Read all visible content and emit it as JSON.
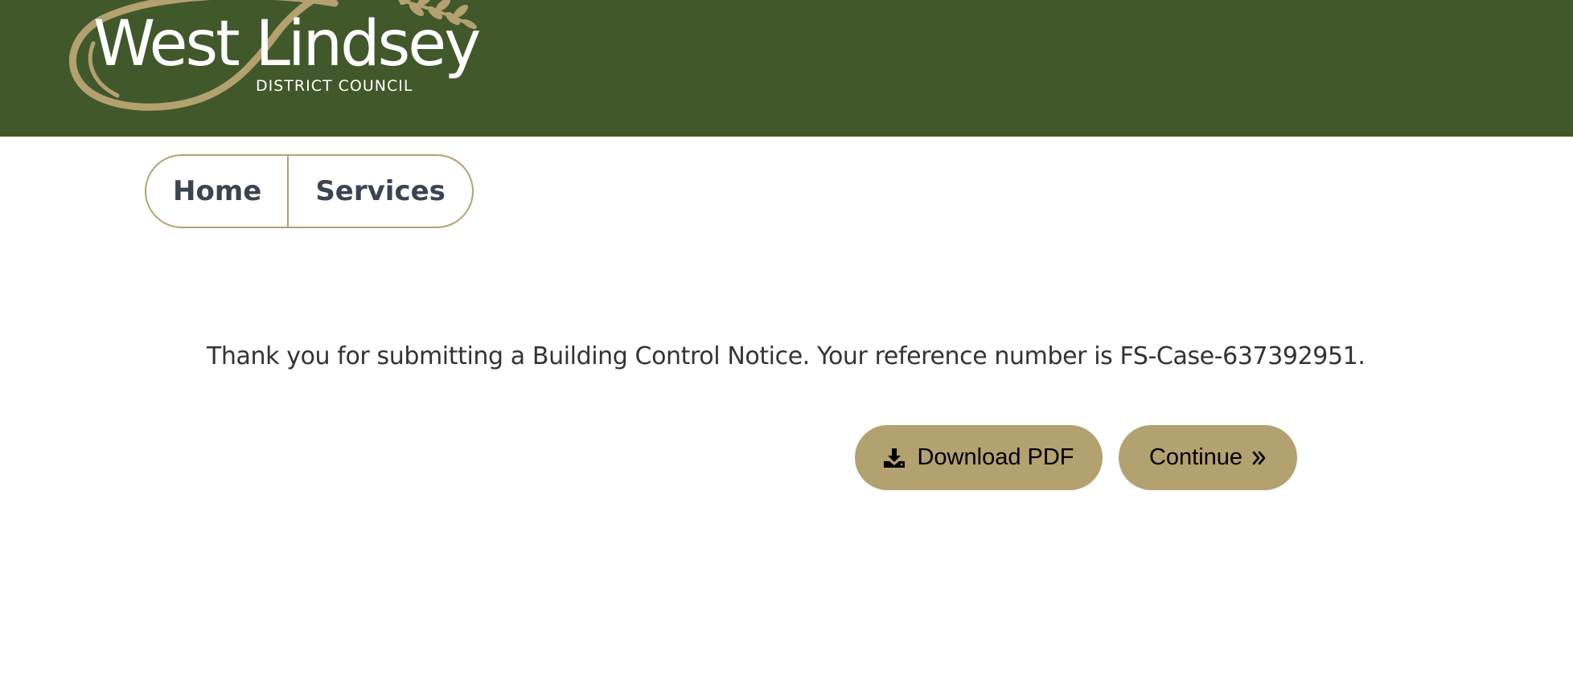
{
  "header": {
    "logo": {
      "name": "West Lindsey",
      "subtitle": "DISTRICT COUNCIL",
      "icon": "wheat-swoosh-logo"
    },
    "background_color": "#41582b",
    "accent_color": "#b3a16f"
  },
  "nav": {
    "items": [
      {
        "label": "Home"
      },
      {
        "label": "Services"
      }
    ]
  },
  "main": {
    "message": "Thank you for submitting a Building Control Notice. Your reference number is FS-Case-637392951.",
    "buttons": {
      "download_label": "Download PDF",
      "download_icon": "download-icon",
      "continue_label": "Continue",
      "continue_icon": "double-chevron-right-icon"
    }
  }
}
